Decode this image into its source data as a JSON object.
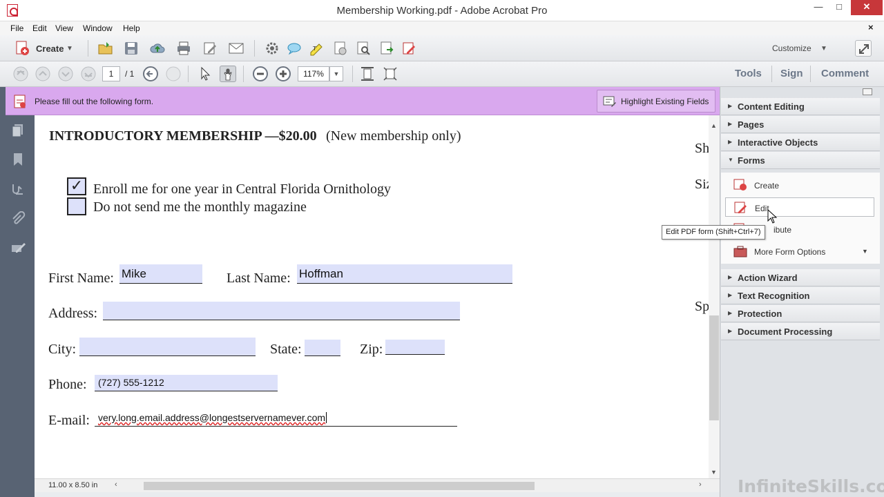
{
  "window": {
    "title": "Membership Working.pdf - Adobe Acrobat Pro",
    "minimize": "—",
    "maximize": "□",
    "close": "✕"
  },
  "menu": [
    "File",
    "Edit",
    "View",
    "Window",
    "Help"
  ],
  "menu_close": "×",
  "toolbar1": {
    "create_label": "Create",
    "customize_label": "Customize"
  },
  "toolbar2": {
    "page_current": "1",
    "page_total": "/ 1",
    "zoom": "117%"
  },
  "right_tabs": [
    "Tools",
    "Sign",
    "Comment"
  ],
  "form_bar": {
    "message": "Please fill out the following form.",
    "highlight_button": "Highlight Existing Fields"
  },
  "document": {
    "heading_bold": "INTRODUCTORY MEMBERSHIP —$20.00",
    "heading_rest": "(New membership only)",
    "checkbox1": {
      "label": "Enroll me for one year in Central Florida Ornithology",
      "checked_glyph": "✓"
    },
    "checkbox2": {
      "label": "Do not send me the monthly magazine",
      "checked_glyph": ""
    },
    "labels": {
      "first_name": "First Name:",
      "last_name": "Last Name:",
      "address": "Address:",
      "city": "City:",
      "state": "State:",
      "zip": "Zip:",
      "phone": "Phone:",
      "email": "E-mail:"
    },
    "values": {
      "first_name": "Mike",
      "last_name": "Hoffman",
      "address": "",
      "city": "",
      "state": "",
      "zip": "",
      "phone": "(727) 555-1212",
      "email": "very.long.email.address@longestservernamever.com"
    },
    "cut_off_right": [
      "Sh",
      "Siz",
      "Sp"
    ]
  },
  "status": {
    "page_size": "11.00 x 8.50 in"
  },
  "right_pane": {
    "panels": [
      {
        "label": "Content Editing",
        "expanded": false
      },
      {
        "label": "Pages",
        "expanded": false
      },
      {
        "label": "Interactive Objects",
        "expanded": false
      },
      {
        "label": "Forms",
        "expanded": true
      },
      {
        "label": "Action Wizard",
        "expanded": false
      },
      {
        "label": "Text Recognition",
        "expanded": false
      },
      {
        "label": "Protection",
        "expanded": false
      },
      {
        "label": "Document Processing",
        "expanded": false
      }
    ],
    "forms_items": {
      "create": "Create",
      "edit": "Edit",
      "distribute_partial": "ibute",
      "more": "More Form Options"
    }
  },
  "tooltip": "Edit PDF form (Shift+Ctrl+7)",
  "watermark": "InfiniteSkills.com",
  "colors": {
    "form_bar": "#d9a8ee",
    "field_fill": "#dde1fa",
    "left_nav": "#586373",
    "close_button": "#c7373a"
  }
}
